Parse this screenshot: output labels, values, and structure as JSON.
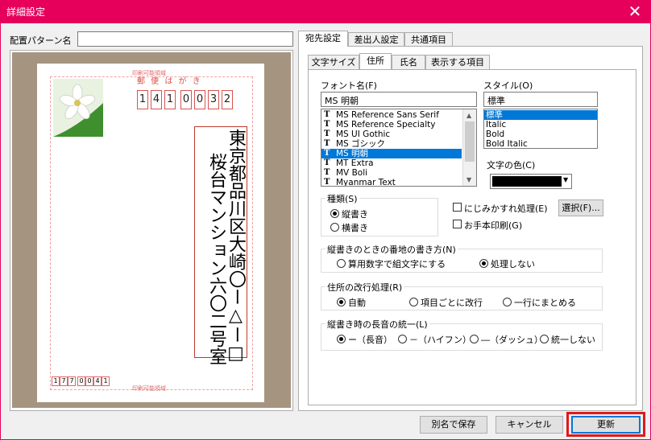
{
  "window": {
    "title": "詳細設定",
    "close_glyph": "✕"
  },
  "pattern_name": {
    "label": "配置パターン名",
    "value": ""
  },
  "preview": {
    "postcard_header": "郵 便 は が き",
    "print_area_top": "印刷可能領域",
    "print_area_bottom": "印刷可能領域",
    "zip_digits": [
      "1",
      "4",
      "1",
      "0",
      "0",
      "3",
      "2"
    ],
    "address_line1": "東京都品川区大崎〇ー△ー□",
    "address_line2": "桜台マンション六〇二号室",
    "sender_zip": [
      "1",
      "7",
      "7",
      "0",
      "0",
      "4",
      "1"
    ]
  },
  "main_tabs": [
    "宛先設定",
    "差出人設定",
    "共通項目"
  ],
  "sub_tabs": [
    "文字サイズ",
    "住所",
    "氏名",
    "表示する項目"
  ],
  "font": {
    "label": "フォント名(F)",
    "value": "MS 明朝",
    "items": [
      "MS Reference Sans Serif",
      "MS Reference Specialty",
      "MS UI Gothic",
      "MS ゴシック",
      "MS 明朝",
      "MT Extra",
      "MV Boli",
      "Myanmar Text"
    ],
    "selected_index": 4
  },
  "style": {
    "label": "スタイル(O)",
    "value": "標準",
    "items": [
      "標準",
      "Italic",
      "Bold",
      "Bold Italic"
    ],
    "selected_index": 0
  },
  "color": {
    "label": "文字の色(C)",
    "swatch": "#000000"
  },
  "kind": {
    "label": "種類(S)",
    "options": [
      "縦書き",
      "横書き"
    ],
    "selected": 0
  },
  "blur_label": "にじみかすれ処理(E)",
  "select_button": "選択(F)...",
  "tehon_label": "お手本印刷(G)",
  "house_number": {
    "label": "縦書きのときの番地の書き方(N)",
    "options": [
      "算用数字で組文字にする",
      "処理しない"
    ],
    "selected": 1
  },
  "line_break": {
    "label": "住所の改行処理(R)",
    "options": [
      "自動",
      "項目ごとに改行",
      "一行にまとめる"
    ],
    "selected": 0
  },
  "long_vowel": {
    "label": "縦書き時の長音の統一(L)",
    "options": [
      "ー（長音）",
      "－（ハイフン）",
      "―（ダッシュ）",
      "統一しない"
    ],
    "selected": 0
  },
  "buttons": {
    "save_as": "別名で保存",
    "cancel": "キャンセル",
    "update": "更新"
  },
  "colors": {
    "title_bar": "#e6005c",
    "highlight": "#e0191c",
    "selection": "#0078d7",
    "preview_bg": "#a59480",
    "postcard_red": "#d9534f"
  }
}
